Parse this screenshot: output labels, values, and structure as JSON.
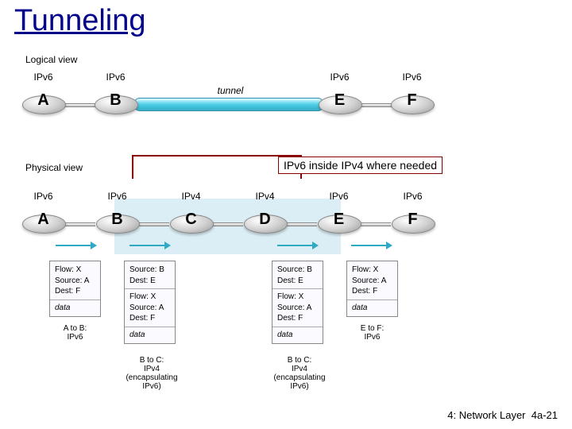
{
  "title": "Tunneling",
  "logical": {
    "label": "Logical view",
    "tunnel": "tunnel",
    "nodes": [
      {
        "letter": "A",
        "proto": "IPv6"
      },
      {
        "letter": "B",
        "proto": "IPv6"
      },
      {
        "letter": "E",
        "proto": "IPv6"
      },
      {
        "letter": "F",
        "proto": "IPv6"
      }
    ]
  },
  "physical": {
    "label": "Physical view",
    "nodes": [
      {
        "letter": "A",
        "proto": "IPv6"
      },
      {
        "letter": "B",
        "proto": "IPv6"
      },
      {
        "letter": "C",
        "proto": "IPv4"
      },
      {
        "letter": "D",
        "proto": "IPv4"
      },
      {
        "letter": "E",
        "proto": "IPv6"
      },
      {
        "letter": "F",
        "proto": "IPv6"
      }
    ]
  },
  "callout": "IPv6 inside IPv4 where needed",
  "packets": {
    "ab": {
      "lines": [
        "Flow: X",
        "Source: A",
        "Dest: F",
        "",
        "data"
      ],
      "caption": "A to B:\nIPv6"
    },
    "bc": {
      "lines": [
        "Source: B",
        "Dest: E",
        "",
        "Flow: X",
        "Source: A",
        "Dest: F",
        "",
        "data"
      ],
      "caption": "B to C:\nIPv4\n(encapsulating\nIPv6)"
    },
    "de": {
      "lines": [
        "Source: B",
        "Dest: E",
        "",
        "Flow: X",
        "Source: A",
        "Dest: F",
        "",
        "data"
      ],
      "caption": "B to C:\nIPv4\n(encapsulating\nIPv6)"
    },
    "ef": {
      "lines": [
        "Flow: X",
        "Source: A",
        "Dest: F",
        "",
        "data"
      ],
      "caption": "E to F:\nIPv6"
    }
  },
  "footer": {
    "chapter": "4: Network Layer",
    "page": "4a-21"
  }
}
